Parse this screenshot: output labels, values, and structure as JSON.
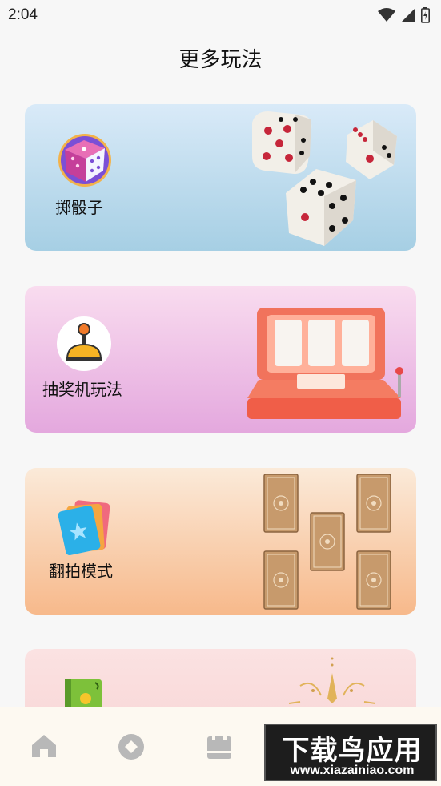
{
  "status_bar": {
    "time": "2:04"
  },
  "page_title": "更多玩法",
  "cards": [
    {
      "label": "掷骰子",
      "icon": "dice-cube-icon"
    },
    {
      "label": "抽奖机玩法",
      "icon": "joystick-icon"
    },
    {
      "label": "翻拍模式",
      "icon": "cards-icon"
    },
    {
      "label": "",
      "icon": "book-icon"
    }
  ],
  "bottom_nav": {
    "items": [
      {
        "icon": "home-icon"
      },
      {
        "icon": "discover-icon"
      },
      {
        "icon": "calendar-icon"
      }
    ]
  },
  "watermark": {
    "main": "下载鸟应用",
    "sub": "www.xiazainiao.com"
  },
  "colors": {
    "dice_card": "#a6cfe4",
    "slot_card": "#e4a8de",
    "flip_card": "#f7b98b",
    "fourth_card": "#f6cfcf",
    "nav_bg": "#fdf9f1",
    "nav_icon": "#b8b8b8"
  }
}
